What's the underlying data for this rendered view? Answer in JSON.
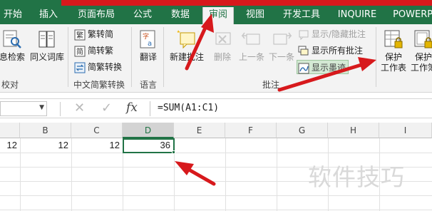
{
  "tabs": [
    {
      "label": "开始",
      "active": false
    },
    {
      "label": "插入",
      "active": false
    },
    {
      "label": "页面布局",
      "active": false
    },
    {
      "label": "公式",
      "active": false
    },
    {
      "label": "数据",
      "active": false
    },
    {
      "label": "审阅",
      "active": true
    },
    {
      "label": "视图",
      "active": false
    },
    {
      "label": "开发工具",
      "active": false
    },
    {
      "label": "INQUIRE",
      "active": false
    },
    {
      "label": "POWERPI",
      "active": false
    }
  ],
  "ribbon": {
    "proofing": {
      "items": [
        "息检索",
        "同义词库"
      ],
      "group_label": "校对"
    },
    "chinese": {
      "items": [
        "繁转简",
        "简转繁",
        "简繁转换"
      ],
      "group_label": "中文简繁转换"
    },
    "language": {
      "items": [
        "翻译"
      ],
      "group_label": "语言"
    },
    "comments": {
      "new_comment": "新建批注",
      "delete": "删除",
      "previous": "上一条",
      "next": "下一条",
      "show_hide": "显示/隐藏批注",
      "show_all": "显示所有批注",
      "show_ink": "显示墨迹",
      "group_label": "批注"
    },
    "protect": {
      "sheet": [
        "保护",
        "工作表"
      ],
      "workbook": [
        "保护",
        "工作簿"
      ]
    }
  },
  "formula_bar": {
    "name_box": "",
    "formula": "=SUM(A1:C1)"
  },
  "grid": {
    "columns": [
      "B",
      "C",
      "D",
      "E",
      "F",
      "G",
      "H",
      "I"
    ],
    "selected_column": "D",
    "row1": {
      "A": "12",
      "B": "12",
      "C": "12",
      "D": "36"
    }
  },
  "watermark": "软件技巧",
  "colors": {
    "accent": "#217346",
    "highlight_band": "#d7191c",
    "arrow": "#d7191c"
  }
}
